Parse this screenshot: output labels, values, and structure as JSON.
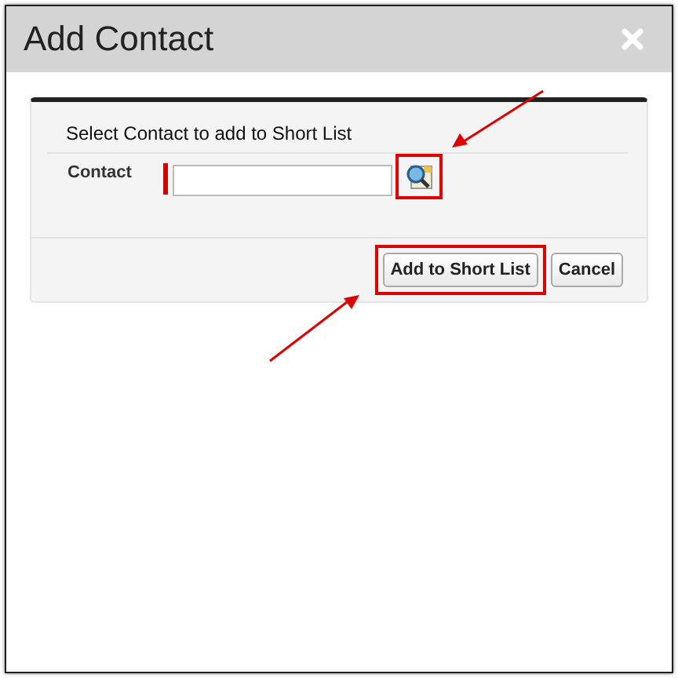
{
  "dialog": {
    "title": "Add Contact"
  },
  "form": {
    "heading": "Select Contact to add to Short List",
    "fields": [
      {
        "label": "Contact",
        "required": true,
        "lookup_highlighted": true
      }
    ],
    "buttons": [
      {
        "label": "Add to Short List",
        "highlighted": true
      },
      {
        "label": "Cancel",
        "highlighted": false
      }
    ]
  },
  "annotations": [
    {
      "kind": "arrow"
    },
    {
      "kind": "arrow"
    }
  ]
}
